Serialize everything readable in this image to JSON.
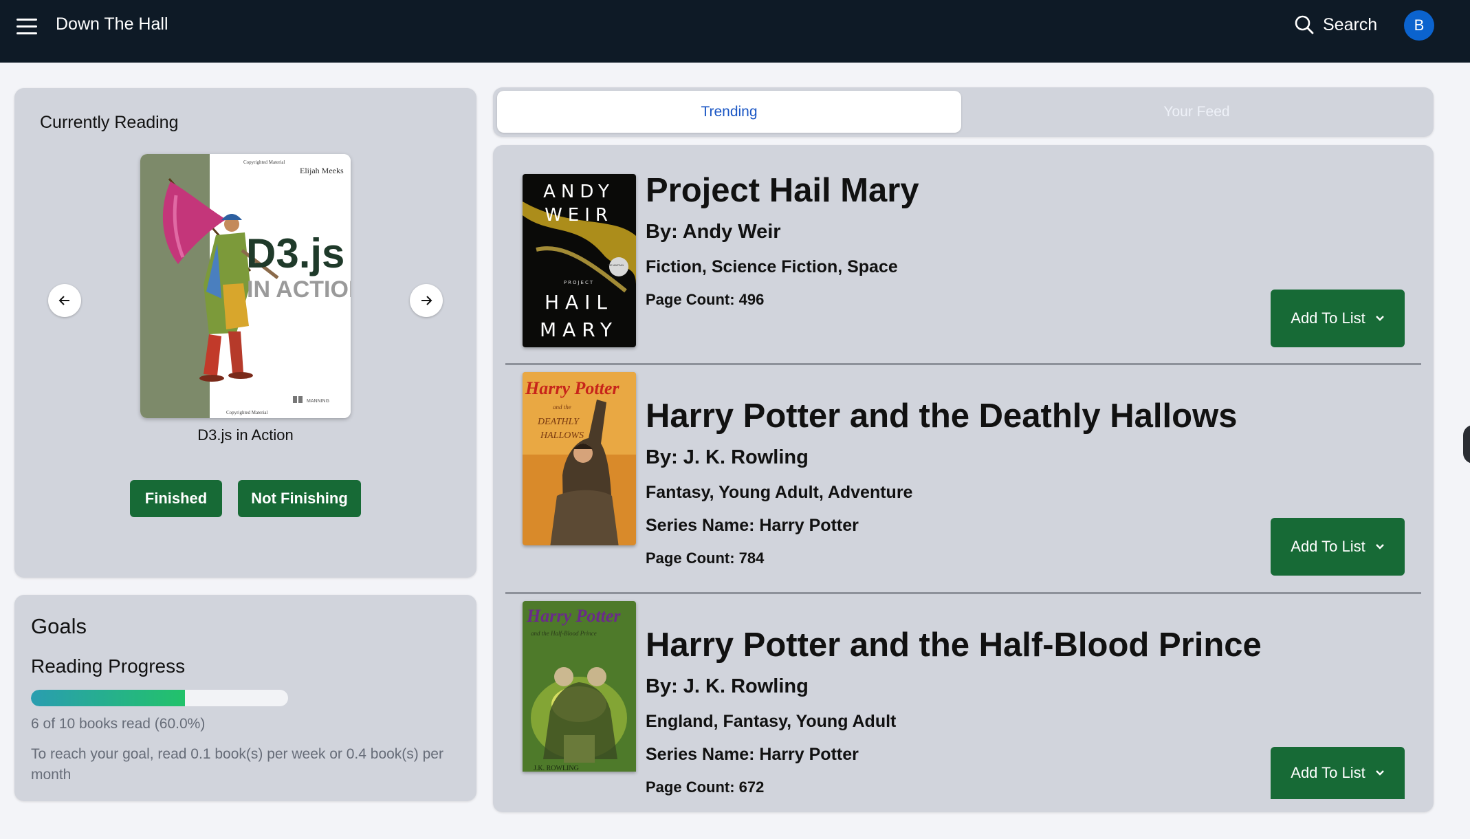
{
  "header": {
    "app_title": "Down The Hall",
    "search_label": "Search",
    "avatar_initial": "B",
    "menu_icon": "hamburger-menu-icon",
    "search_icon": "search-icon"
  },
  "currently_reading": {
    "title": "Currently Reading",
    "book_title": "D3.js in Action",
    "cover": {
      "top_line": "Copyrighted Material",
      "author": "Elijah Meeks",
      "title_main": "D3.js",
      "title_sub": "IN ACTION",
      "publisher": "MANNING",
      "bottom_line": "Copyrighted Material"
    },
    "prev_icon": "arrow-left-icon",
    "next_icon": "arrow-right-icon",
    "finished_label": "Finished",
    "not_finishing_label": "Not Finishing"
  },
  "goals": {
    "title": "Goals",
    "reading_progress_title": "Reading Progress",
    "books_read": 6,
    "books_goal": 10,
    "progress_fraction": 0.6,
    "progress_text": "6 of 10 books read (60.0%)",
    "pace_text": "To reach your goal, read 0.1 book(s) per week or 0.4 book(s) per month"
  },
  "tabs": [
    {
      "label": "Trending",
      "active": true
    },
    {
      "label": "Your Feed",
      "active": false
    }
  ],
  "feed": [
    {
      "title": "Project Hail Mary",
      "author": "By: Andy Weir",
      "genres": "Fiction, Science Fiction, Space",
      "series": "",
      "page_count": "Page Count: 496",
      "add_label": "Add To List",
      "cover_lines": [
        "ANDY",
        "WEIR",
        "PROJECT",
        "HAIL",
        "MARY"
      ],
      "cover_badge": "THE MARTIAN"
    },
    {
      "title": "Harry Potter and the Deathly Hallows",
      "author": "By: J. K. Rowling",
      "genres": "Fantasy, Young Adult, Adventure",
      "series": "Series Name: Harry Potter",
      "page_count": "Page Count: 784",
      "add_label": "Add To List",
      "cover_lines": [
        "Harry Potter",
        "and the",
        "DEATHLY",
        "HALLOWS"
      ]
    },
    {
      "title": "Harry Potter and the Half-Blood Prince",
      "author": "By: J. K. Rowling",
      "genres": "England, Fantasy, Young Adult",
      "series": "Series Name: Harry Potter",
      "page_count": "Page Count: 672",
      "add_label": "Add To List",
      "cover_lines": [
        "Harry Potter",
        "and the Half-Blood Prince",
        "J.K. ROWLING"
      ]
    }
  ],
  "colors": {
    "topbar": "#0e1a26",
    "primary_green": "#176a36",
    "panel": "#d1d4dc",
    "tab_active_text": "#1a56c4",
    "avatar": "#0b63ce"
  }
}
